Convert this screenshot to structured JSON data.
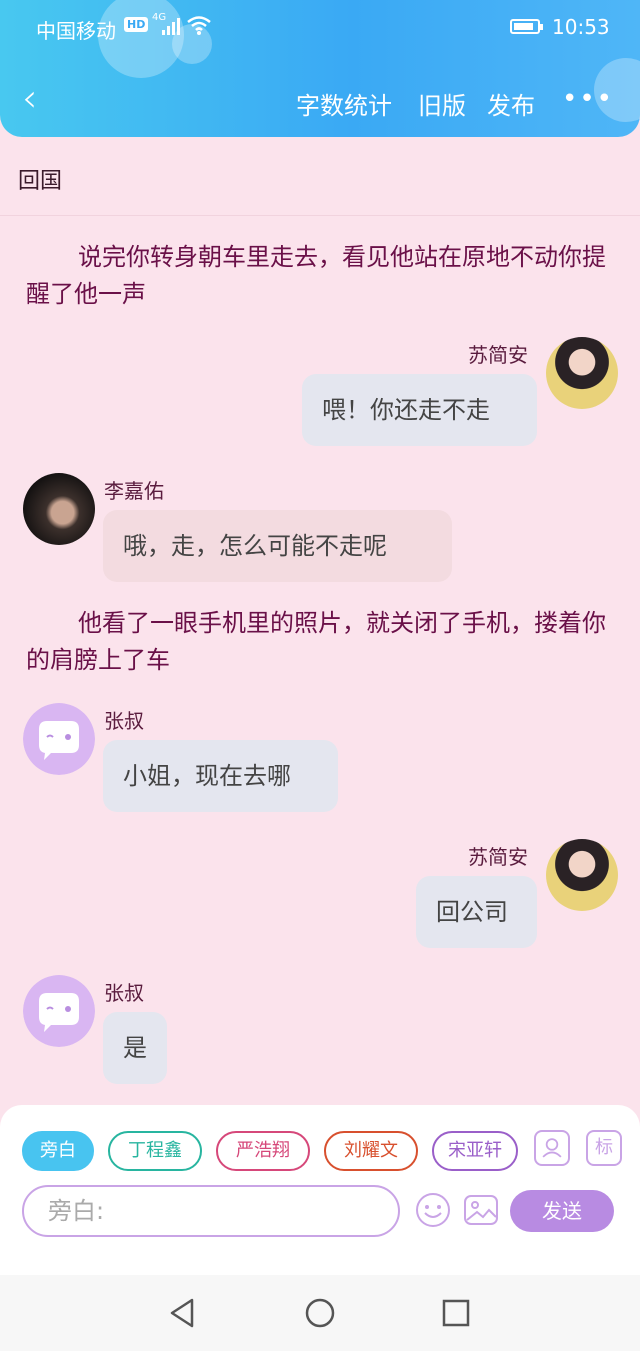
{
  "status_bar": {
    "carrier": "中国移动",
    "hd": "HD",
    "network": "4G",
    "time": "10:53",
    "battery_level": 0.85
  },
  "nav": {
    "actions": [
      "字数统计",
      "旧版",
      "发布"
    ],
    "more": "•••"
  },
  "chapter_title": "回国",
  "messages": [
    {
      "type": "narration",
      "text": "说完你转身朝车里走去，看见他站在原地不动你提醒了他一声"
    },
    {
      "type": "right",
      "name": "苏简安",
      "text": "喂！你还走不走"
    },
    {
      "type": "left",
      "name": "李嘉佑",
      "text": "哦，走，怎么可能不走呢"
    },
    {
      "type": "narration",
      "text": "他看了一眼手机里的照片，就关闭了手机，搂着你的肩膀上了车"
    },
    {
      "type": "left",
      "name": "张叔",
      "text": "小姐，现在去哪"
    },
    {
      "type": "right",
      "name": "苏简安",
      "text": "回公司"
    },
    {
      "type": "left",
      "name": "张叔",
      "text": "是"
    }
  ],
  "characters": [
    {
      "label": "旁白",
      "color": "#48c4f0",
      "selected": true
    },
    {
      "label": "丁程鑫",
      "color": "#28b5a0",
      "selected": false
    },
    {
      "label": "严浩翔",
      "color": "#d6487a",
      "selected": false
    },
    {
      "label": "刘耀文",
      "color": "#d8502e",
      "selected": false
    },
    {
      "label": "宋亚轩",
      "color": "#9a5fc9",
      "selected": false
    }
  ],
  "input": {
    "placeholder": "旁白:",
    "mark_label": "标",
    "send_label": "发送"
  },
  "colors": {
    "header": "#3aa9f4",
    "background": "#fbe3ec",
    "accent": "#b88be2"
  }
}
